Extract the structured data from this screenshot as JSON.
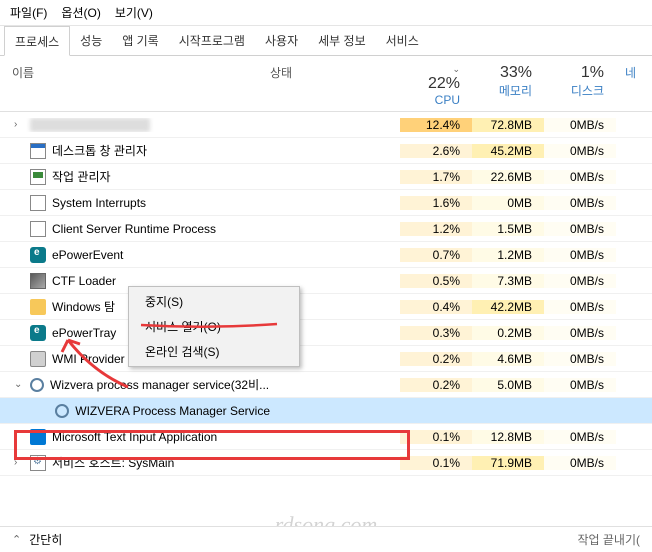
{
  "menu": {
    "file": "파일(F)",
    "options": "옵션(O)",
    "view": "보기(V)"
  },
  "tabs": [
    "프로세스",
    "성능",
    "앱 기록",
    "시작프로그램",
    "사용자",
    "세부 정보",
    "서비스"
  ],
  "activeTab": 0,
  "headers": {
    "name": "이름",
    "status": "상태",
    "cpu": {
      "pct": "22%",
      "label": "CPU"
    },
    "mem": {
      "pct": "33%",
      "label": "메모리"
    },
    "disk": {
      "pct": "1%",
      "label": "디스크"
    },
    "net": "네"
  },
  "rows": [
    {
      "expand": "›",
      "icon": "blur",
      "name": "",
      "cpu": "12.4%",
      "cpuHi": true,
      "mem": "72.8MB",
      "memHi": true,
      "disk": "0MB/s"
    },
    {
      "expand": "",
      "icon": "window",
      "name": "데스크톱 창 관리자",
      "cpu": "2.6%",
      "mem": "45.2MB",
      "memHi": true,
      "disk": "0MB/s"
    },
    {
      "expand": "",
      "icon": "mon",
      "name": "작업 관리자",
      "cpu": "1.7%",
      "mem": "22.6MB",
      "disk": "0MB/s"
    },
    {
      "expand": "",
      "icon": "sys",
      "name": "System Interrupts",
      "cpu": "1.6%",
      "mem": "0MB",
      "disk": "0MB/s"
    },
    {
      "expand": "",
      "icon": "sys",
      "name": "Client Server Runtime Process",
      "cpu": "1.2%",
      "mem": "1.5MB",
      "disk": "0MB/s"
    },
    {
      "expand": "",
      "icon": "ep",
      "name": "ePowerEvent",
      "cpu": "0.7%",
      "mem": "1.2MB",
      "disk": "0MB/s"
    },
    {
      "expand": "",
      "icon": "ctf",
      "name": "CTF Loader",
      "cpu": "0.5%",
      "mem": "7.3MB",
      "disk": "0MB/s"
    },
    {
      "expand": "",
      "icon": "folder",
      "name": "Windows 탐",
      "cpu": "0.4%",
      "mem": "42.2MB",
      "memHi": true,
      "disk": "0MB/s"
    },
    {
      "expand": "",
      "icon": "ep",
      "name": "ePowerTray",
      "cpu": "0.3%",
      "mem": "0.2MB",
      "disk": "0MB/s"
    },
    {
      "expand": "",
      "icon": "wmi",
      "name": "WMI Provider Host",
      "cpu": "0.2%",
      "mem": "4.6MB",
      "disk": "0MB/s"
    },
    {
      "expand": "⌄",
      "icon": "gear",
      "name": "Wizvera process manager service(32비...",
      "cpu": "0.2%",
      "mem": "5.0MB",
      "disk": "0MB/s"
    },
    {
      "expand": "",
      "icon": "gear",
      "name": "WIZVERA Process Manager Service",
      "indent": true,
      "selected": true,
      "cpu": "",
      "mem": "",
      "disk": ""
    },
    {
      "expand": "›",
      "icon": "ms",
      "name": "Microsoft Text Input Application",
      "cpu": "0.1%",
      "mem": "12.8MB",
      "disk": "0MB/s"
    },
    {
      "expand": "›",
      "icon": "svc",
      "name": "서비스 호스트: SysMain",
      "cpu": "0.1%",
      "mem": "71.9MB",
      "memHi": true,
      "disk": "0MB/s"
    }
  ],
  "contextMenu": [
    "중지(S)",
    "서비스 열기(O)",
    "온라인 검색(S)"
  ],
  "footer": {
    "label": "간단히",
    "right": "작업 끝내기("
  },
  "watermark": "rdsong.com"
}
